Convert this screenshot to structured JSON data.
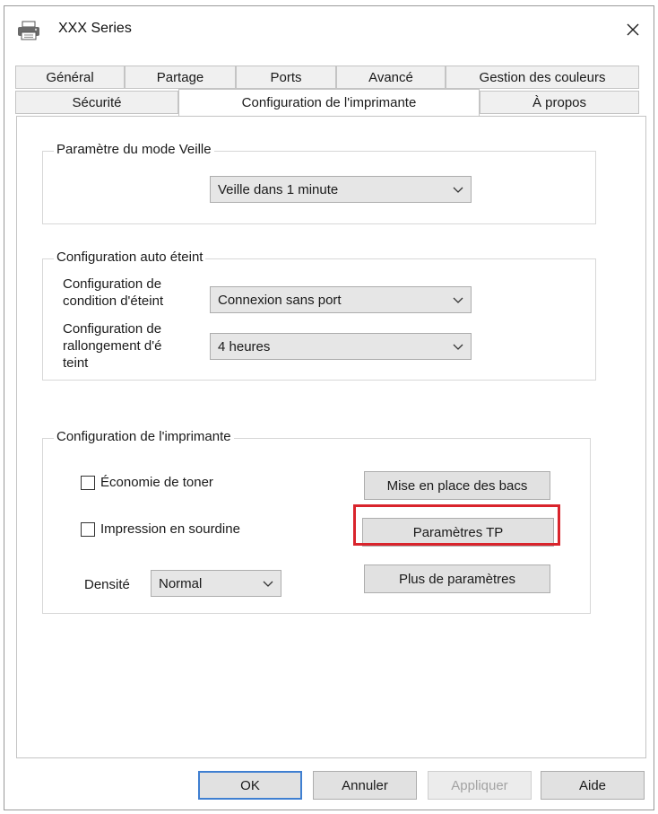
{
  "window": {
    "title": "XXX  Series",
    "icon": "printer-icon"
  },
  "tabs": {
    "row1": [
      {
        "label": "Général"
      },
      {
        "label": "Partage"
      },
      {
        "label": "Ports"
      },
      {
        "label": "Avancé"
      },
      {
        "label": "Gestion des couleurs"
      }
    ],
    "row2": [
      {
        "label": "Sécurité"
      },
      {
        "label": "Configuration de l'imprimante",
        "active": true
      },
      {
        "label": "À propos"
      }
    ]
  },
  "sleep": {
    "legend": "Paramètre du mode Veille",
    "value": "Veille dans 1 minute"
  },
  "auto_off": {
    "legend": "Configuration auto éteint",
    "condition_label_1": "Configuration de",
    "condition_label_2": "condition d'éteint",
    "condition_value": "Connexion sans port",
    "extension_label_1": "Configuration de",
    "extension_label_2": "rallongement d'é",
    "extension_label_3": "teint",
    "extension_value": "4 heures"
  },
  "printer_config": {
    "legend": "Configuration de l'imprimante",
    "toner_saving": "Économie de toner",
    "quiet_printing": "Impression en sourdine",
    "density_label": "Densité",
    "density_value": "Normal",
    "tray_button": "Mise en place des bacs",
    "tp_button": "Paramètres TP",
    "more_button": "Plus de paramètres"
  },
  "footer": {
    "ok": "OK",
    "cancel": "Annuler",
    "apply": "Appliquer",
    "help": "Aide"
  },
  "colors": {
    "highlight": "#d9242c",
    "default_button_border": "#3f7fd1"
  }
}
